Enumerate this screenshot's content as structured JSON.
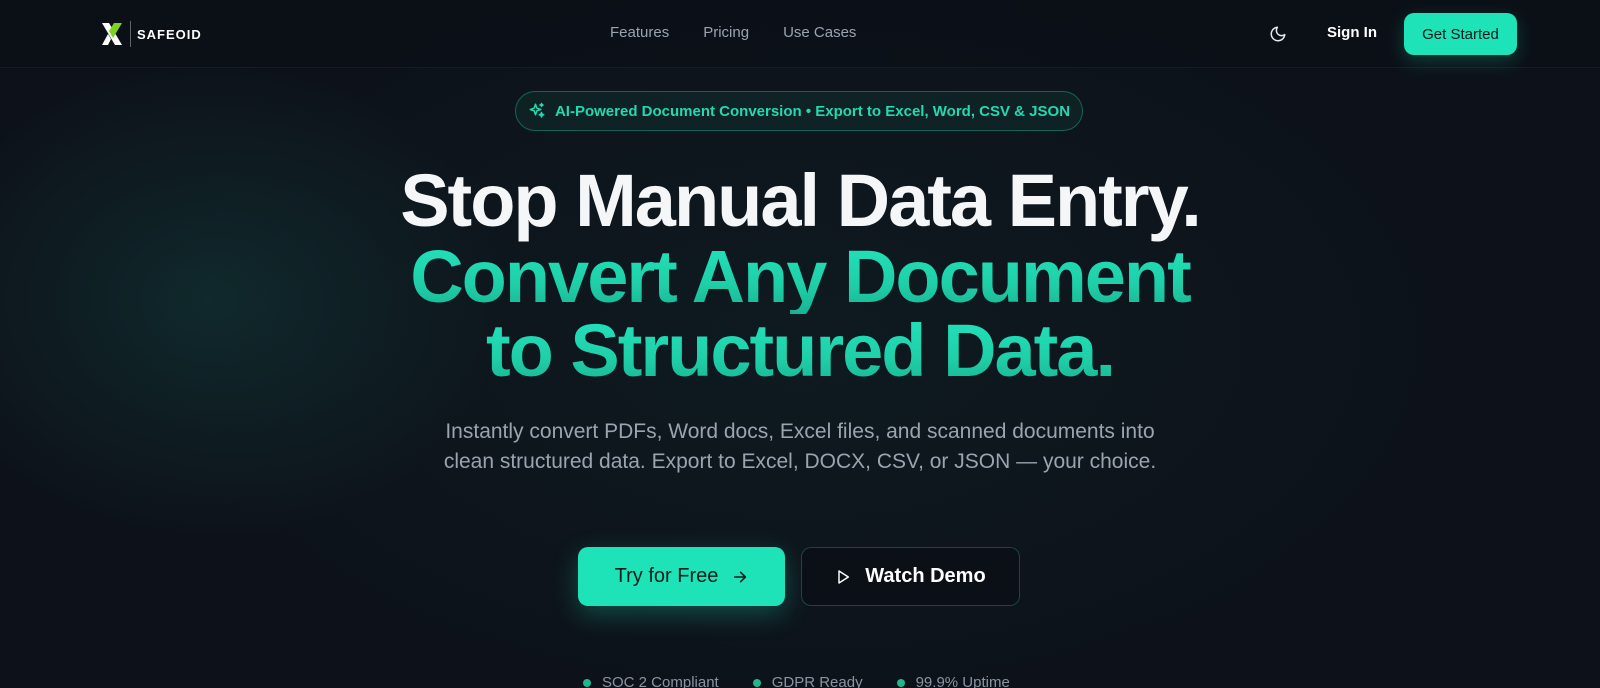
{
  "brand": {
    "name": "SAFEOID",
    "accent": "#1ee3b8",
    "logo_green": "#7ed321"
  },
  "nav": {
    "links": [
      "Features",
      "Pricing",
      "Use Cases"
    ],
    "theme_icon": "moon-icon",
    "sign_in": "Sign In",
    "get_started": "Get Started"
  },
  "badge": {
    "icon": "sparkles-icon",
    "text": "AI-Powered Document Conversion • Export to Excel, Word, CSV & JSON"
  },
  "hero": {
    "line1": "Stop Manual Data Entry.",
    "line2": "Convert Any Document",
    "line3": "to Structured Data.",
    "subtitle": "Instantly convert PDFs, Word docs, Excel files, and scanned documents into clean structured data. Export to Excel, DOCX, CSV, or JSON — your choice."
  },
  "cta": {
    "primary": "Try for Free",
    "primary_icon": "arrow-right-icon",
    "secondary": "Watch Demo",
    "secondary_icon": "play-icon"
  },
  "trust": [
    "SOC 2 Compliant",
    "GDPR Ready",
    "99.9% Uptime"
  ]
}
